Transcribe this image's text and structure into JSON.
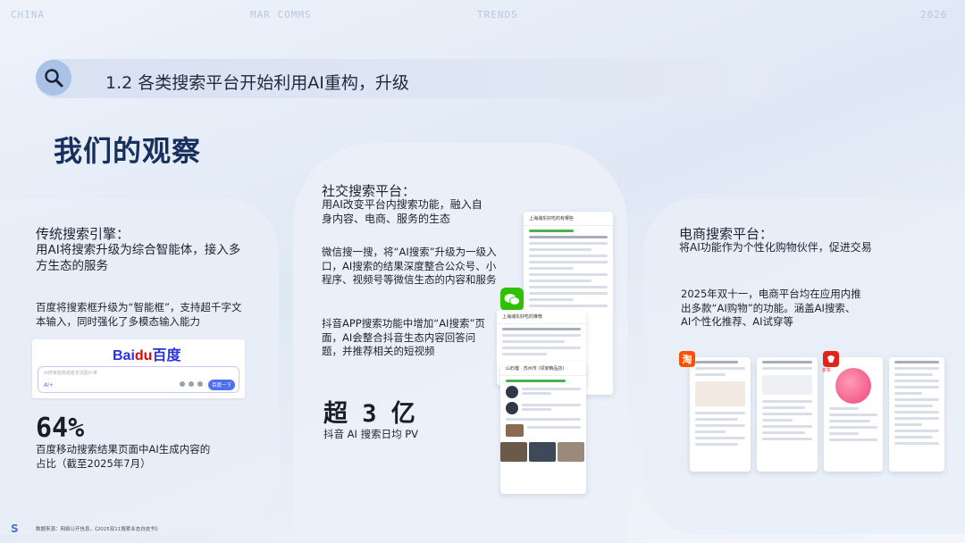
{
  "top_bar": {
    "left": "CHINA",
    "center_left": "MAR COMMS",
    "center_right": "TRENDS",
    "right": "2026"
  },
  "header": {
    "title": "1.2 各类搜索平台开始利用AI重构，升级"
  },
  "page_title": "我们的观察",
  "left_card": {
    "heading": "传统搜索引擎：",
    "subheading": "用AI将搜索升级为综合智能体，接入多方生态的服务",
    "body": "百度将搜索框升级为“智能框”，支持超千字文本输入，同时强化了多模态输入能力",
    "baidu": {
      "logo_a": "Bai",
      "logo_b": "du",
      "logo_c": "百度",
      "placeholder": "AI搜索图像或者发送图片等",
      "ai_label": "AI+",
      "button": "百度一下"
    },
    "stat_value": "64%",
    "stat_label": "百度移动搜索结果页面中AI生成内容的占比（截至2025年7月）"
  },
  "mid_card": {
    "heading": "社交搜索平台：",
    "subheading": "用AI改变平台内搜索功能，融入自身内容、电商、服务的生态",
    "wechat_text": "微信搜一搜，将“AI搜索”升级为一级入口，AI搜索的结果深度整合公众号、小程序、视频号等微信生态的内容和服务",
    "douyin_text": "抖音APP搜索功能中增加“AI搜索”页面，AI会整合抖音生态内容回答问题，并推荐相关的短视频",
    "stat_value": "超 3 亿",
    "stat_label": "抖音 AI 搜索日均 PV",
    "mock_titles": [
      "上海浦东好吃的有哪些",
      "上海浦东好吃的推荐",
      "山石榴 · 苏州市 (邻家精品店)"
    ]
  },
  "right_card": {
    "heading": "电商搜索平台：",
    "subheading": "将AI功能作为个性化购物伙伴，促进交易",
    "body": "2025年双十一，电商平台均在应用内推出多款“AI购物”的功能。涵盖AI搜索、AI个性化推荐、AI试穿等",
    "taobao_icon": "淘",
    "jd_label": "京东"
  },
  "footer": {
    "logo": "S",
    "note": "数据来源：网络公开信息，《2025双11搜索业态白皮书》"
  },
  "colors": {
    "title_blue": "#18305e",
    "accent_blue": "#4a78c9",
    "wechat_green": "#2dc100",
    "taobao_orange": "#ff5000",
    "jd_red": "#e1251b"
  }
}
